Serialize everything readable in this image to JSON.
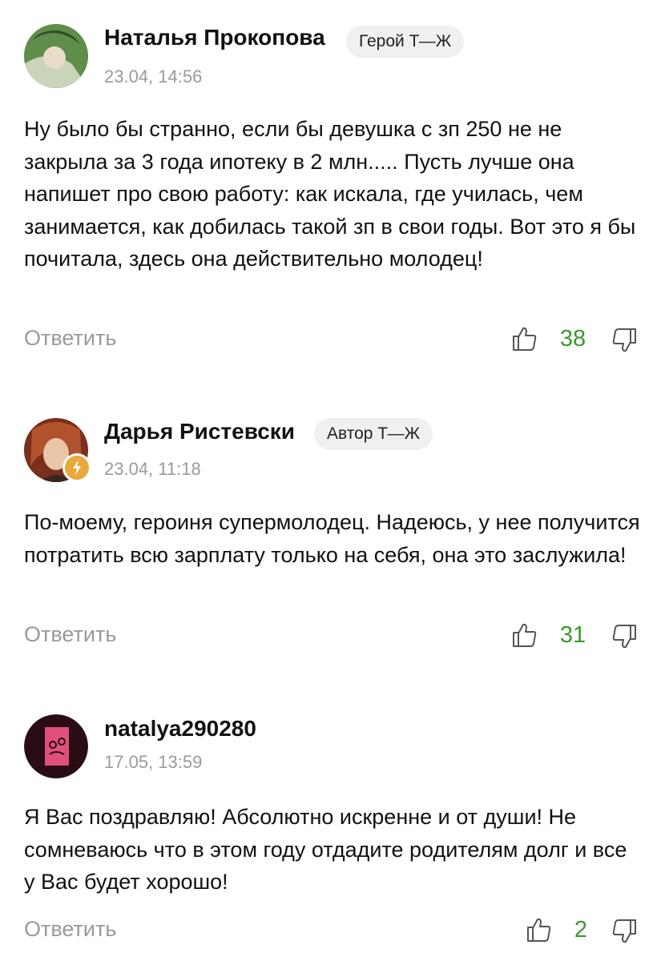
{
  "comments": [
    {
      "author": "Наталья Прокопова",
      "badge": "Герой Т—Ж",
      "date": "23.04, 14:56",
      "text": "Ну было бы странно, если бы девушка с зп 250 не не закрыла за 3 года ипотеку в 2 млн..... Пусть лучше она напишет про свою работу: как искала, где училась, чем занимается, как добилась такой зп в свои годы. Вот это я бы почитала, здесь она действительно молодец!",
      "reply": "Ответить",
      "score": "38"
    },
    {
      "author": "Дарья Ристевски",
      "badge": "Автор Т—Ж",
      "date": "23.04, 11:18",
      "text": "По-моему, героиня супермолодец. Надеюсь, у нее получится потратить всю зарплату только на себя, она это заслужила!",
      "reply": "Ответить",
      "score": "31"
    },
    {
      "author": "natalya290280",
      "date": "17.05, 13:59",
      "text": "Я Вас поздравляю! Абсолютно искренне и от души! Не сомневаюсь что в этом году отдадите родителям долг и все у Вас будет хорошо!",
      "reply": "Ответить",
      "score": "2"
    }
  ],
  "colors": {
    "score": "#3a9a2a",
    "muted": "#9a9a9a",
    "badge_bg": "#f0f0f0",
    "author_mark": "#e8a93a"
  },
  "icons": {
    "like": "thumbs-up-icon",
    "dislike": "thumbs-down-icon",
    "author": "lightning-icon"
  }
}
